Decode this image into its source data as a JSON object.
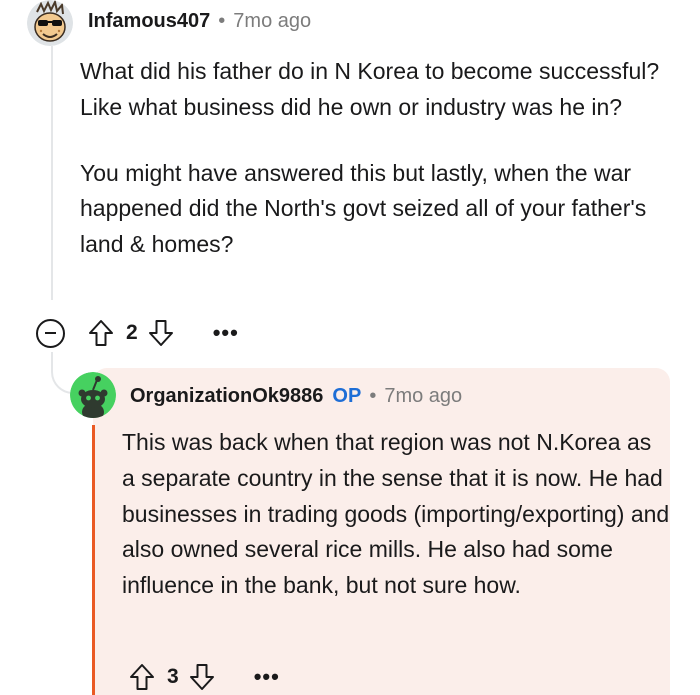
{
  "comment": {
    "author": "Infamous407",
    "separator": "•",
    "time": "7mo ago",
    "paragraphs": [
      "What did his father do in N Korea to become successful? Like what business did he own or industry was he in?",
      "You might have answered this but lastly, when the war happened did the North's govt seized all of your father's land & homes?"
    ],
    "score": "2",
    "more": "•••"
  },
  "reply": {
    "author": "OrganizationOk9886",
    "op_badge": "OP",
    "separator": "•",
    "time": "7mo ago",
    "body": "This was back when that region was not N.Korea as a separate country in the sense that it is now. He had businesses in trading goods (importing/exporting) and also owned several rice mills. He also had some influence in the bank, but not sure how.",
    "score": "3",
    "more": "•••"
  },
  "colors": {
    "op_badge": "#1e6ed6",
    "highlight_background": "#fbeeea",
    "highlight_bar": "#ea5a24",
    "reply_avatar": "#46d160"
  },
  "icons": {
    "comment_avatar": "cartoon-avatar-with-sunglasses-icon",
    "reply_avatar": "snoo-avatar-icon",
    "collapse": "collapse-minus-icon",
    "upvote": "upvote-arrow-icon",
    "downvote": "downvote-arrow-icon",
    "more": "more-options-icon"
  }
}
